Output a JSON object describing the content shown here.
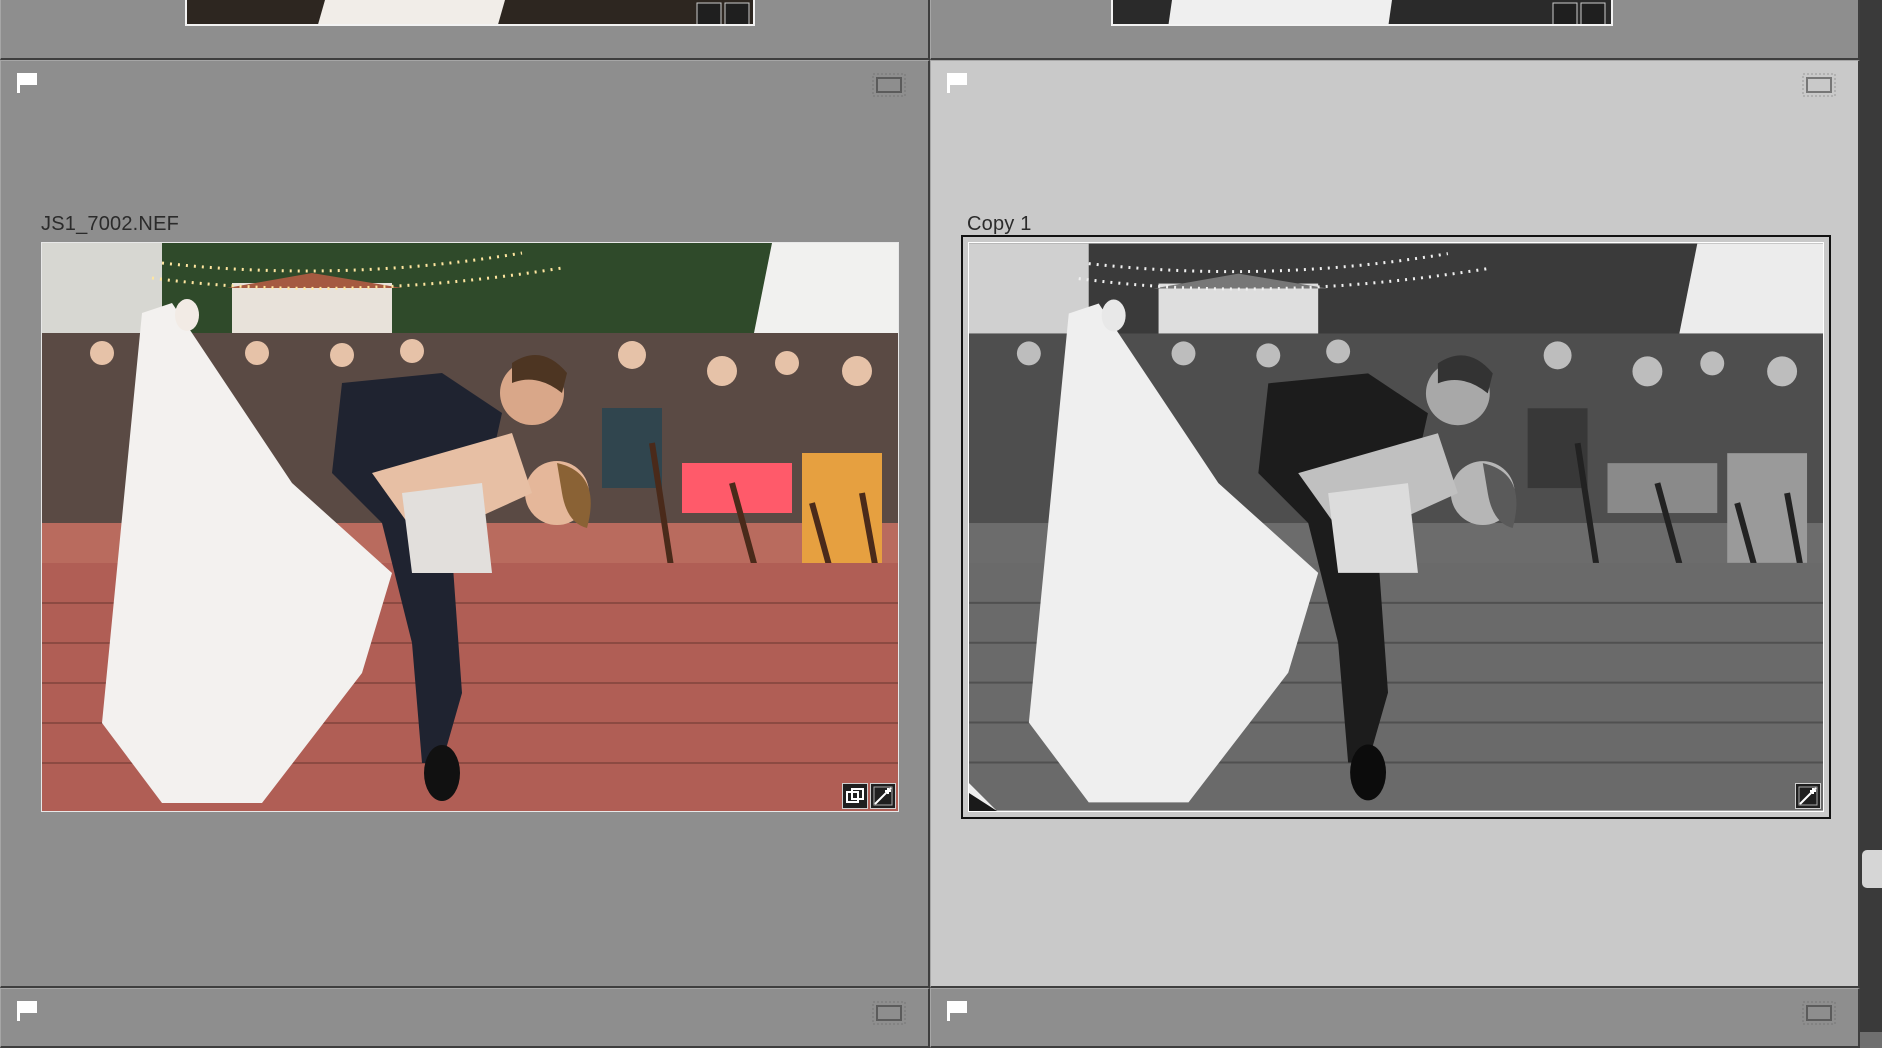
{
  "grid": {
    "cells": [
      {
        "id": "prev-left",
        "selected": false
      },
      {
        "id": "prev-right",
        "selected": false
      },
      {
        "id": "main-left",
        "filename": "JS1_7002.NEF",
        "selected": false,
        "color": true
      },
      {
        "id": "main-right",
        "filename": "Copy 1",
        "selected": true,
        "color": false
      },
      {
        "id": "next-left",
        "selected": false
      },
      {
        "id": "next-right",
        "selected": false
      }
    ]
  },
  "icons": {
    "flag": "flag-icon",
    "badge": "crop-frame-icon",
    "edit": "develop-adjusted-icon",
    "copy": "virtual-copy-icon",
    "fold": "virtual-copy-corner-icon"
  },
  "colors": {
    "cell_bg": "#8e8e8e",
    "selected_bg": "#c9c9c9",
    "scrollbar": "#3a3a3a"
  }
}
